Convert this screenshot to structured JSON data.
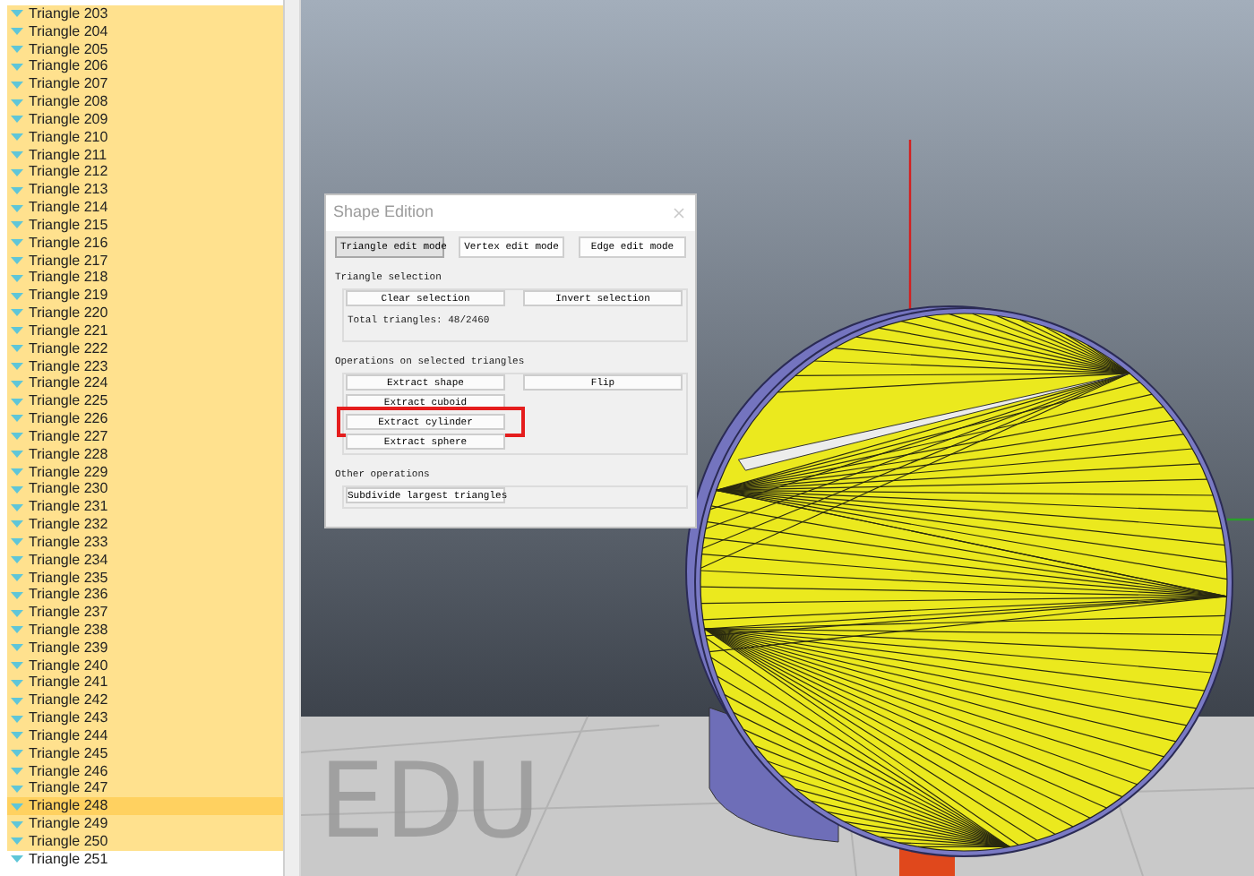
{
  "tree": {
    "items": [
      {
        "label": "Triangle 203",
        "selected": true,
        "current": false
      },
      {
        "label": "Triangle 204",
        "selected": true,
        "current": false
      },
      {
        "label": "Triangle 205",
        "selected": true,
        "current": false
      },
      {
        "label": "Triangle 206",
        "selected": true,
        "current": false
      },
      {
        "label": "Triangle 207",
        "selected": true,
        "current": false
      },
      {
        "label": "Triangle 208",
        "selected": true,
        "current": false
      },
      {
        "label": "Triangle 209",
        "selected": true,
        "current": false
      },
      {
        "label": "Triangle 210",
        "selected": true,
        "current": false
      },
      {
        "label": "Triangle 211",
        "selected": true,
        "current": false
      },
      {
        "label": "Triangle 212",
        "selected": true,
        "current": false
      },
      {
        "label": "Triangle 213",
        "selected": true,
        "current": false
      },
      {
        "label": "Triangle 214",
        "selected": true,
        "current": false
      },
      {
        "label": "Triangle 215",
        "selected": true,
        "current": false
      },
      {
        "label": "Triangle 216",
        "selected": true,
        "current": false
      },
      {
        "label": "Triangle 217",
        "selected": true,
        "current": false
      },
      {
        "label": "Triangle 218",
        "selected": true,
        "current": false
      },
      {
        "label": "Triangle 219",
        "selected": true,
        "current": false
      },
      {
        "label": "Triangle 220",
        "selected": true,
        "current": false
      },
      {
        "label": "Triangle 221",
        "selected": true,
        "current": false
      },
      {
        "label": "Triangle 222",
        "selected": true,
        "current": false
      },
      {
        "label": "Triangle 223",
        "selected": true,
        "current": false
      },
      {
        "label": "Triangle 224",
        "selected": true,
        "current": false
      },
      {
        "label": "Triangle 225",
        "selected": true,
        "current": false
      },
      {
        "label": "Triangle 226",
        "selected": true,
        "current": false
      },
      {
        "label": "Triangle 227",
        "selected": true,
        "current": false
      },
      {
        "label": "Triangle 228",
        "selected": true,
        "current": false
      },
      {
        "label": "Triangle 229",
        "selected": true,
        "current": false
      },
      {
        "label": "Triangle 230",
        "selected": true,
        "current": false
      },
      {
        "label": "Triangle 231",
        "selected": true,
        "current": false
      },
      {
        "label": "Triangle 232",
        "selected": true,
        "current": false
      },
      {
        "label": "Triangle 233",
        "selected": true,
        "current": false
      },
      {
        "label": "Triangle 234",
        "selected": true,
        "current": false
      },
      {
        "label": "Triangle 235",
        "selected": true,
        "current": false
      },
      {
        "label": "Triangle 236",
        "selected": true,
        "current": false
      },
      {
        "label": "Triangle 237",
        "selected": true,
        "current": false
      },
      {
        "label": "Triangle 238",
        "selected": true,
        "current": false
      },
      {
        "label": "Triangle 239",
        "selected": true,
        "current": false
      },
      {
        "label": "Triangle 240",
        "selected": true,
        "current": false
      },
      {
        "label": "Triangle 241",
        "selected": true,
        "current": false
      },
      {
        "label": "Triangle 242",
        "selected": true,
        "current": false
      },
      {
        "label": "Triangle 243",
        "selected": true,
        "current": false
      },
      {
        "label": "Triangle 244",
        "selected": true,
        "current": false
      },
      {
        "label": "Triangle 245",
        "selected": true,
        "current": false
      },
      {
        "label": "Triangle 246",
        "selected": true,
        "current": false
      },
      {
        "label": "Triangle 247",
        "selected": true,
        "current": false
      },
      {
        "label": "Triangle 248",
        "selected": true,
        "current": true
      },
      {
        "label": "Triangle 249",
        "selected": true,
        "current": false
      },
      {
        "label": "Triangle 250",
        "selected": true,
        "current": false
      },
      {
        "label": "Triangle 251",
        "selected": false,
        "current": false
      }
    ]
  },
  "viewport": {
    "watermark": "EDU"
  },
  "dialog": {
    "title": "Shape Edition",
    "modes": [
      {
        "label": "Triangle edit mode",
        "selected": true
      },
      {
        "label": "Vertex edit mode",
        "selected": false
      },
      {
        "label": "Edge edit mode",
        "selected": false
      }
    ],
    "sections": [
      {
        "title": "Triangle selection",
        "left_buttons": [
          {
            "label": "Clear selection",
            "highlighted": false
          }
        ],
        "right_buttons": [
          {
            "label": "Invert selection",
            "highlighted": false
          }
        ],
        "info": "Total triangles: 48/2460"
      },
      {
        "title": "Operations on selected triangles",
        "left_buttons": [
          {
            "label": "Extract shape",
            "highlighted": false
          },
          {
            "label": "Extract cuboid",
            "highlighted": false
          },
          {
            "label": "Extract cylinder",
            "highlighted": true
          },
          {
            "label": "Extract sphere",
            "highlighted": false
          }
        ],
        "right_buttons": [
          {
            "label": "Flip",
            "highlighted": false
          }
        ]
      },
      {
        "title": "Other operations",
        "left_buttons": [
          {
            "label": "Subdivide largest triangles",
            "highlighted": false
          }
        ]
      }
    ]
  }
}
